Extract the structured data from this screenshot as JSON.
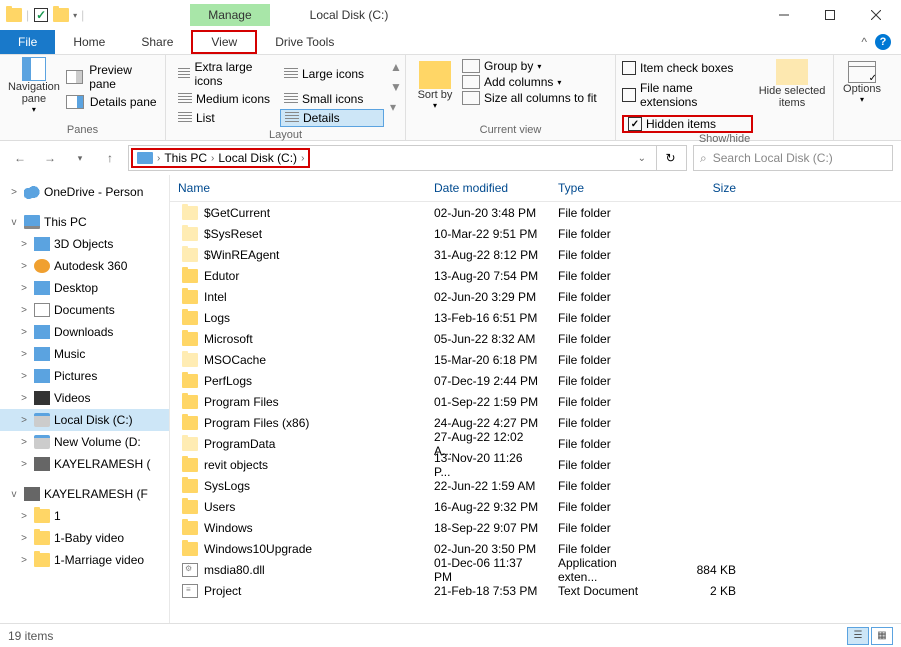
{
  "title": {
    "tab": "Manage",
    "text": "Local Disk (C:)"
  },
  "menu": {
    "file": "File",
    "home": "Home",
    "share": "Share",
    "view": "View",
    "drivetools": "Drive Tools"
  },
  "ribbon": {
    "nav_pane": "Navigation pane",
    "preview_pane": "Preview pane",
    "details_pane": "Details pane",
    "panes_label": "Panes",
    "layout": {
      "xl": "Extra large icons",
      "lg": "Large icons",
      "md": "Medium icons",
      "sm": "Small icons",
      "list": "List",
      "details": "Details",
      "label": "Layout"
    },
    "sort_by": "Sort by",
    "group_by": "Group by",
    "add_columns": "Add columns",
    "size_all": "Size all columns to fit",
    "current_view_label": "Current view",
    "item_check": "Item check boxes",
    "file_ext": "File name extensions",
    "hidden_items": "Hidden items",
    "hide_selected": "Hide selected items",
    "showhide_label": "Show/hide",
    "options": "Options"
  },
  "addressbar": {
    "this_pc": "This PC",
    "location": "Local Disk (C:)"
  },
  "search": {
    "placeholder": "Search Local Disk (C:)"
  },
  "sidebar": [
    {
      "exp": ">",
      "ico": "ico-cloud",
      "label": "OneDrive - Person",
      "indent": 8
    },
    {
      "exp": "v",
      "ico": "ico-pc",
      "label": "This PC",
      "indent": 8,
      "top_gap": true
    },
    {
      "exp": ">",
      "ico": "ico-3d",
      "label": "3D Objects",
      "indent": 18
    },
    {
      "exp": ">",
      "ico": "ico-360",
      "label": "Autodesk 360",
      "indent": 18
    },
    {
      "exp": ">",
      "ico": "ico-desktop",
      "label": "Desktop",
      "indent": 18
    },
    {
      "exp": ">",
      "ico": "ico-doc",
      "label": "Documents",
      "indent": 18
    },
    {
      "exp": ">",
      "ico": "ico-down",
      "label": "Downloads",
      "indent": 18
    },
    {
      "exp": ">",
      "ico": "ico-music",
      "label": "Music",
      "indent": 18
    },
    {
      "exp": ">",
      "ico": "ico-pic",
      "label": "Pictures",
      "indent": 18
    },
    {
      "exp": ">",
      "ico": "ico-vid",
      "label": "Videos",
      "indent": 18
    },
    {
      "exp": ">",
      "ico": "ico-disk",
      "label": "Local Disk (C:)",
      "indent": 18,
      "selected": true
    },
    {
      "exp": ">",
      "ico": "ico-disk",
      "label": "New Volume (D:",
      "indent": 18
    },
    {
      "exp": ">",
      "ico": "ico-usb",
      "label": "KAYELRAMESH (",
      "indent": 18
    },
    {
      "exp": "v",
      "ico": "ico-usb",
      "label": "KAYELRAMESH (F",
      "indent": 8,
      "top_gap": true
    },
    {
      "exp": ">",
      "ico": "ico-folder",
      "label": "1",
      "indent": 18
    },
    {
      "exp": ">",
      "ico": "ico-folder",
      "label": "1-Baby video",
      "indent": 18
    },
    {
      "exp": ">",
      "ico": "ico-folder",
      "label": "1-Marriage video",
      "indent": 18
    }
  ],
  "columns": {
    "name": "Name",
    "date": "Date modified",
    "type": "Type",
    "size": "Size"
  },
  "files": [
    {
      "ico": "ico-folder-dim",
      "name": "$GetCurrent",
      "date": "02-Jun-20 3:48 PM",
      "type": "File folder",
      "size": ""
    },
    {
      "ico": "ico-folder-dim",
      "name": "$SysReset",
      "date": "10-Mar-22 9:51 PM",
      "type": "File folder",
      "size": ""
    },
    {
      "ico": "ico-folder-dim",
      "name": "$WinREAgent",
      "date": "31-Aug-22 8:12 PM",
      "type": "File folder",
      "size": ""
    },
    {
      "ico": "ico-folder",
      "name": "Edutor",
      "date": "13-Aug-20 7:54 PM",
      "type": "File folder",
      "size": ""
    },
    {
      "ico": "ico-folder",
      "name": "Intel",
      "date": "02-Jun-20 3:29 PM",
      "type": "File folder",
      "size": ""
    },
    {
      "ico": "ico-folder",
      "name": "Logs",
      "date": "13-Feb-16 6:51 PM",
      "type": "File folder",
      "size": ""
    },
    {
      "ico": "ico-folder",
      "name": "Microsoft",
      "date": "05-Jun-22 8:32 AM",
      "type": "File folder",
      "size": ""
    },
    {
      "ico": "ico-folder-dim",
      "name": "MSOCache",
      "date": "15-Mar-20 6:18 PM",
      "type": "File folder",
      "size": ""
    },
    {
      "ico": "ico-folder",
      "name": "PerfLogs",
      "date": "07-Dec-19 2:44 PM",
      "type": "File folder",
      "size": ""
    },
    {
      "ico": "ico-folder",
      "name": "Program Files",
      "date": "01-Sep-22 1:59 PM",
      "type": "File folder",
      "size": ""
    },
    {
      "ico": "ico-folder",
      "name": "Program Files (x86)",
      "date": "24-Aug-22 4:27 PM",
      "type": "File folder",
      "size": ""
    },
    {
      "ico": "ico-folder-dim",
      "name": "ProgramData",
      "date": "27-Aug-22 12:02 A...",
      "type": "File folder",
      "size": ""
    },
    {
      "ico": "ico-folder",
      "name": "revit objects",
      "date": "13-Nov-20 11:26 P...",
      "type": "File folder",
      "size": ""
    },
    {
      "ico": "ico-folder",
      "name": "SysLogs",
      "date": "22-Jun-22 1:59 AM",
      "type": "File folder",
      "size": ""
    },
    {
      "ico": "ico-folder",
      "name": "Users",
      "date": "16-Aug-22 9:32 PM",
      "type": "File folder",
      "size": ""
    },
    {
      "ico": "ico-folder",
      "name": "Windows",
      "date": "18-Sep-22 9:07 PM",
      "type": "File folder",
      "size": ""
    },
    {
      "ico": "ico-folder",
      "name": "Windows10Upgrade",
      "date": "02-Jun-20 3:50 PM",
      "type": "File folder",
      "size": ""
    },
    {
      "ico": "ico-dll",
      "name": "msdia80.dll",
      "date": "01-Dec-06 11:37 PM",
      "type": "Application exten...",
      "size": "884 KB"
    },
    {
      "ico": "ico-txt",
      "name": "Project",
      "date": "21-Feb-18 7:53 PM",
      "type": "Text Document",
      "size": "2 KB"
    }
  ],
  "status": {
    "count": "19 items"
  }
}
